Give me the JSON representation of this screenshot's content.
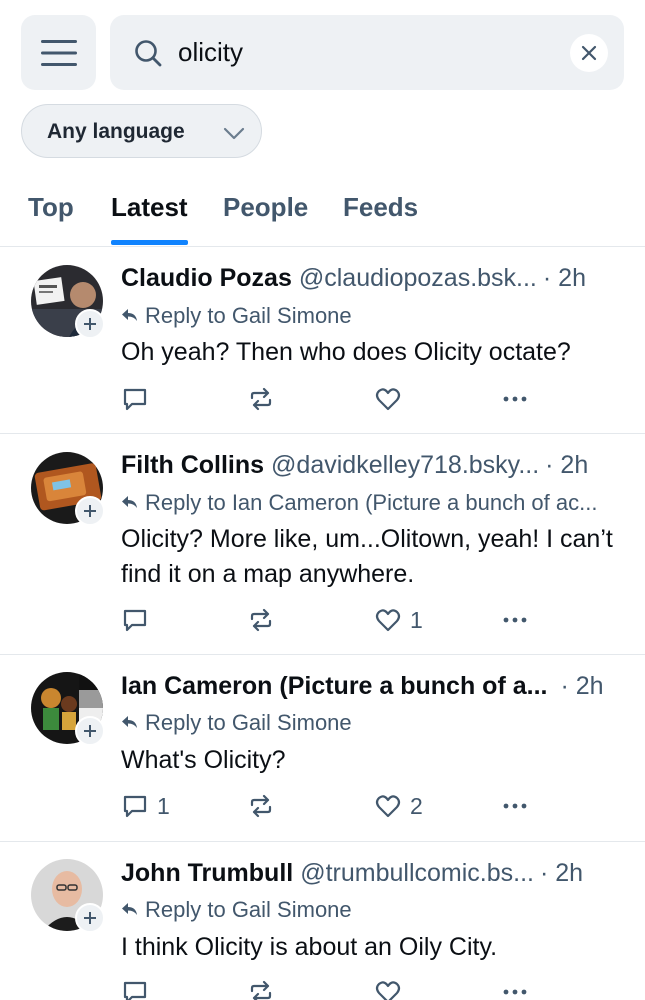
{
  "search": {
    "query": "olicity",
    "language_filter": "Any language"
  },
  "tabs": [
    {
      "label": "Top",
      "active": false
    },
    {
      "label": "Latest",
      "active": true
    },
    {
      "label": "People",
      "active": false
    },
    {
      "label": "Feeds",
      "active": false
    }
  ],
  "colors": {
    "accent": "#1083fe",
    "muted": "#42576c",
    "surface": "#eef1f4"
  },
  "posts": [
    {
      "author": "Claudio Pozas",
      "handle": "@claudiopozas.bsk...",
      "time": "· 2h",
      "reply_to": "Reply to Gail Simone",
      "text": "Oh yeah? Then who does Olicity octate?",
      "replies": "",
      "reposts": "",
      "likes": ""
    },
    {
      "author": "Filth Collins",
      "handle": "@davidkelley718.bsky...",
      "time": "· 2h",
      "reply_to": "Reply to Ian Cameron (Picture a bunch of ac...",
      "text": "Olicity? More like, um...Olitown, yeah! I can’t find it on a map anywhere.",
      "replies": "",
      "reposts": "",
      "likes": "1"
    },
    {
      "author": "Ian Cameron (Picture a bunch of a...",
      "handle": "",
      "time": "· 2h",
      "reply_to": "Reply to Gail Simone",
      "text": "What's Olicity?",
      "replies": "1",
      "reposts": "",
      "likes": "2"
    },
    {
      "author": "John Trumbull",
      "handle": "@trumbullcomic.bs...",
      "time": "· 2h",
      "reply_to": "Reply to Gail Simone",
      "text": "I think Olicity is about an Oily City.",
      "replies": "",
      "reposts": "",
      "likes": ""
    }
  ]
}
